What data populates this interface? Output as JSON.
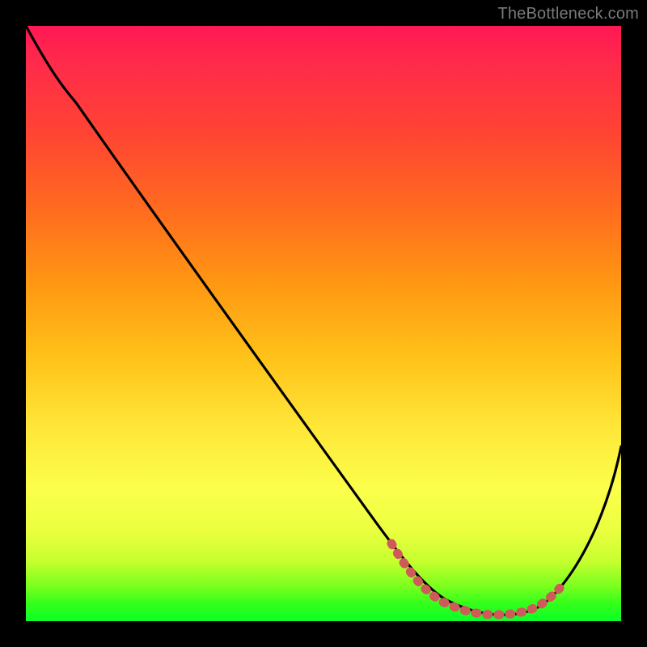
{
  "watermark": "TheBottleneck.com",
  "chart_data": {
    "type": "line",
    "title": "",
    "xlabel": "",
    "ylabel": "",
    "xlim": [
      0,
      100
    ],
    "ylim": [
      0,
      100
    ],
    "x": [
      0,
      6,
      14,
      22,
      30,
      38,
      46,
      54,
      60,
      64,
      68,
      72,
      76,
      80,
      84,
      88,
      92,
      96,
      100
    ],
    "values": [
      100,
      94,
      84,
      74,
      64,
      54,
      44,
      34,
      24,
      16,
      9,
      4,
      1,
      0,
      0,
      2,
      8,
      18,
      31
    ],
    "series": [
      {
        "name": "bottleneck-curve",
        "color": "#000000"
      }
    ],
    "marker_segment": {
      "color": "#cf5a5a",
      "x": [
        60,
        64,
        68,
        72,
        76,
        80,
        84,
        88
      ],
      "values": [
        6,
        3,
        1.5,
        0.7,
        0.4,
        0.4,
        0.9,
        2.5
      ]
    },
    "gradient_stops": [
      {
        "pos": 0,
        "color": "#ff1854"
      },
      {
        "pos": 50,
        "color": "#ffc31a"
      },
      {
        "pos": 80,
        "color": "#fbff4b"
      },
      {
        "pos": 100,
        "color": "#0bff27"
      }
    ]
  }
}
